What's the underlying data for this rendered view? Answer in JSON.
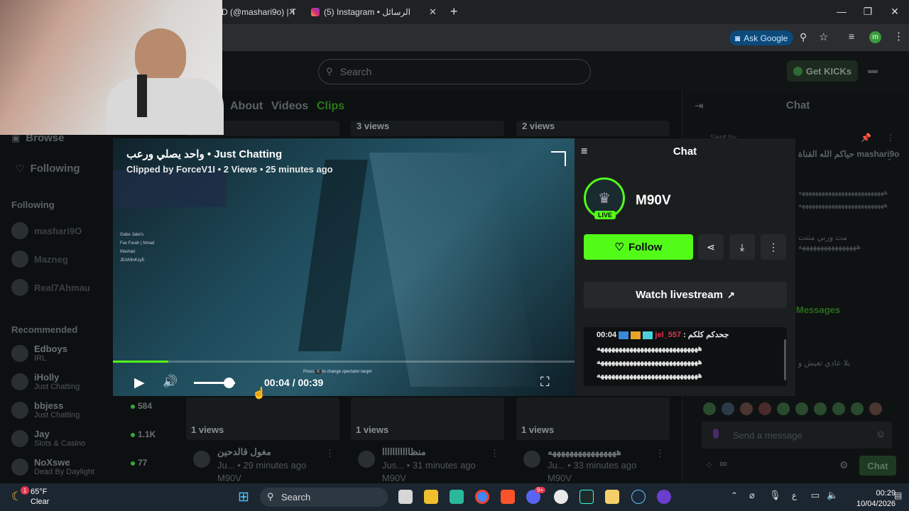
{
  "browser": {
    "tabs": [
      {
        "label": "D (@mashari9o) | T"
      },
      {
        "label": "(5) Instagram • الرسائل"
      }
    ],
    "ask_google": "Ask Google",
    "profile_initial": "m"
  },
  "site": {
    "search_placeholder": "Search",
    "get_kicks": "Get KICKs",
    "profile_tabs": [
      "About",
      "Videos",
      "Clips"
    ],
    "active_tab": "Clips"
  },
  "sidebar": {
    "browse": "Browse",
    "following": "Following",
    "following_header": "Following",
    "following_users": [
      "mashari9O",
      "Mazneg",
      "Real7Ahmau"
    ],
    "recommended_header": "Recommended",
    "recommended": [
      {
        "name": "Edboys",
        "category": "IRL",
        "viewers": ""
      },
      {
        "name": "iHolly",
        "category": "Just Chatting",
        "viewers": ""
      },
      {
        "name": "bbjess",
        "category": "Just Chatting",
        "viewers": "584"
      },
      {
        "name": "Jay",
        "category": "Slots & Casino",
        "viewers": "1.1K"
      },
      {
        "name": "NoXswe",
        "category": "Dead By Daylight",
        "viewers": "77"
      }
    ]
  },
  "grid": {
    "top_views": [
      "3 views",
      "2 views"
    ],
    "cards": [
      {
        "views": "1 views",
        "title": "مغول قالدحين",
        "time": "Ju... • 29 minutes ago",
        "channel": "M90V"
      },
      {
        "views": "1 views",
        "title": "منظااااااااااا",
        "time": "Jus... • 31 minutes ago",
        "channel": "M90V"
      },
      {
        "views": "1 views",
        "title": "ههههههههههههههههه",
        "time": "Ju... • 33 minutes ago",
        "channel": "M90V"
      }
    ]
  },
  "chat_dim": {
    "title": "Chat",
    "pinned": "Sent by",
    "pinned_msg": "حياكم الله القناة mashari9o",
    "lines": [
      "ههههههههههههههههههههههههههه",
      "ههههههههههههههههههههههههههه",
      "مت وربي مثتت ههههههههههههههههه",
      "بلا عادي تعيش و"
    ],
    "new_messages": "Messages",
    "send_placeholder": "Send a message",
    "chat_button": "Chat"
  },
  "clip": {
    "title": "واحد يصلي ورعب • Just Chatting",
    "subtitle": "Clipped by ForceV1I • 2 Views • 25 minutes ago",
    "time": "00:04 / 00:39",
    "progress": 0.12,
    "volume": 0.85,
    "spectator_hint_press": "Press",
    "spectator_hint_key": "X",
    "spectator_hint": "to change spectator target",
    "overlay_names": [
      "Gabe Jake's",
      "Fax Farah | Nmad",
      "Mashari.",
      "JEAMinKzyE"
    ]
  },
  "panel": {
    "title": "Chat",
    "live": "LIVE",
    "streamer": "M90V",
    "follow": "Follow",
    "watch": "Watch livestream",
    "chat": [
      {
        "time": "00:04",
        "user": "jel_557",
        "text": ": جحدكم كلكم"
      },
      {
        "time": "",
        "user": "",
        "text": "ههههههههههههههههههههههههههههه"
      },
      {
        "time": "",
        "user": "",
        "text": "ههههههههههههههههههههههههههههه"
      },
      {
        "time": "",
        "user": "",
        "text": "ههههههههههههههههههههههههههههه"
      }
    ]
  },
  "taskbar": {
    "weather_temp": "65°F",
    "weather_desc": "Clear",
    "weather_badge": "1",
    "search": "Search",
    "time": "00:29",
    "date": "10/04/2026",
    "lang": "ع",
    "discord_badge": "9+"
  },
  "colors": {
    "accent": "#53fc18",
    "username": "#e0364e"
  }
}
